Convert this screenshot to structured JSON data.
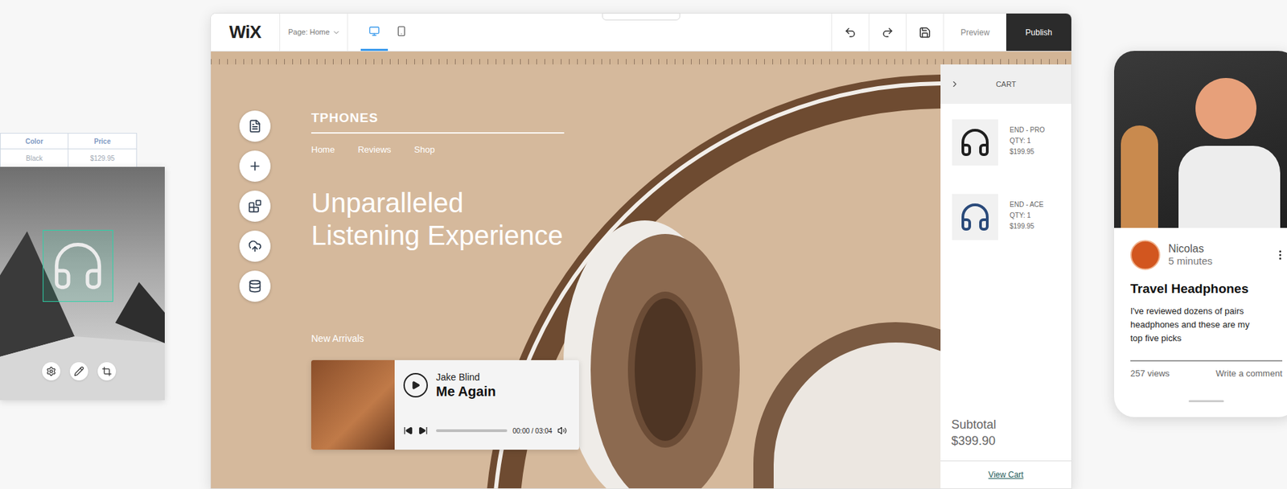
{
  "left_card": {
    "table": {
      "columns": [
        "Color",
        "Price"
      ],
      "rows": [
        [
          "Black",
          "$129.95"
        ]
      ]
    }
  },
  "editor": {
    "logo": "WiX",
    "page_selector": "Page: Home",
    "view_modes": [
      {
        "kind": "desktop",
        "selected": true
      },
      {
        "kind": "mobile",
        "selected": false
      }
    ],
    "preview": "Preview",
    "publish": "Publish"
  },
  "site": {
    "brand": "TPHONES",
    "nav": [
      "Home",
      "Reviews",
      "Shop"
    ],
    "headline": [
      "Unparalleled",
      "Listening Experience"
    ],
    "section": "New Arrivals",
    "player": {
      "artist": "Jake Blind",
      "title": "Me Again",
      "time": "00:00 / 03:04",
      "level": 0
    }
  },
  "cart": {
    "title": "CART",
    "items": [
      {
        "name": "END - PRO",
        "qty": "QTY: 1",
        "price": "$199.95",
        "color": "#1f1f1f"
      },
      {
        "name": "END - ACE",
        "qty": "QTY: 1",
        "price": "$199.95",
        "color": "#2a4a7a"
      }
    ],
    "subtotal_label": "Subtotal",
    "subtotal": "$399.90",
    "link": "View Cart"
  },
  "post": {
    "author": "Nicolas",
    "time": "5 minutes",
    "title": "Travel Headphones",
    "excerpt": "I've reviewed dozens of pairs headphones and these are my top five picks",
    "views": "257 views",
    "comment": "Write a comment"
  }
}
